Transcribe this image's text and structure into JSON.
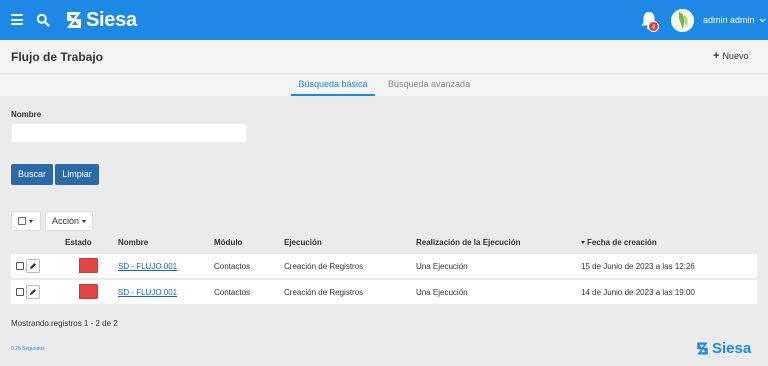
{
  "header": {
    "brand": "Siesa",
    "notification_count": "4",
    "user_name": "admin admin"
  },
  "page": {
    "title": "Flujo de Trabajo",
    "new_label": "Nuevo"
  },
  "tabs": [
    {
      "label": "Búsqueda básica",
      "active": true
    },
    {
      "label": "Búsqueda avanzada",
      "active": false
    }
  ],
  "search": {
    "nombre_label": "Nombre",
    "nombre_value": "",
    "buscar_label": "Buscar",
    "limpiar_label": "Limpiar"
  },
  "toolbar": {
    "accion_label": "Acción"
  },
  "table": {
    "columns": [
      "Estado",
      "Nombre",
      "Módulo",
      "Ejecución",
      "Realización de la Ejecución",
      "Fecha de creación"
    ],
    "sort_column": "Fecha de creación",
    "rows": [
      {
        "estado": "inactive",
        "nombre": "SD - FLUJO 001",
        "modulo": "Contactos",
        "ejecucion": "Creación de Registros",
        "realizacion": "Una Ejecución",
        "fecha": "15 de Junio de 2023 a las 12:26"
      },
      {
        "estado": "inactive",
        "nombre": "SD - FLUJO 001",
        "modulo": "Contactos",
        "ejecucion": "Creación de Registros",
        "realizacion": "Una Ejecución",
        "fecha": "14 de Junio de 2023 a las 19:00"
      }
    ]
  },
  "footer": {
    "count_text": "Mostrando registros 1 - 2 de 2",
    "time_text": "0.26 Segundos",
    "brand": "Siesa"
  },
  "colors": {
    "primary": "#1e88e5",
    "button": "#2b6aa7",
    "status_inactive": "#e04646"
  }
}
